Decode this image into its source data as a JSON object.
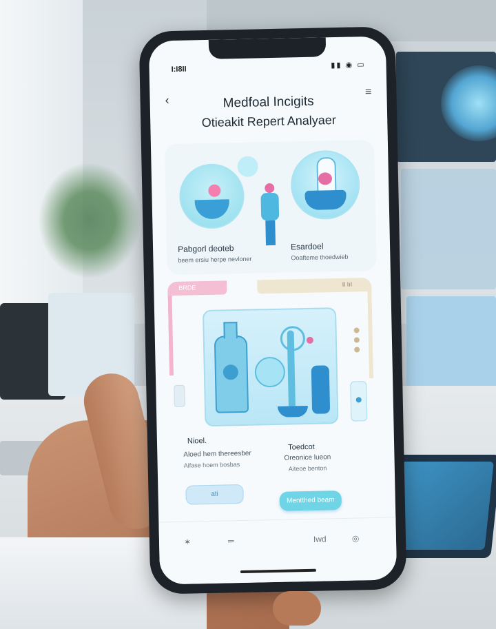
{
  "status": {
    "time": "I:I8II",
    "icons": "▮▮ ◉ ▭"
  },
  "header": {
    "back": "‹",
    "menu": "≡",
    "title": "Medfoal Incigits",
    "subtitle": "Otieakit Repert Analyaer"
  },
  "top_card": {
    "left_label": "Pabgorl deoteb",
    "left_sub": "beem ersiu herpe nevloner",
    "right_label": "Esardoel",
    "right_sub": "Ooafteme thoedwieb"
  },
  "mid_card": {
    "pink_tab": "BRDE",
    "beige_tab": "Il IıI"
  },
  "info": {
    "left_title": "Nioel.",
    "left_line1": "Aloed hem thereesber",
    "left_line2": "Aifase hoem bosbas",
    "right_title": "Toedcot",
    "right_line1": "Oreonice lueon",
    "right_line2": "Aiteoe benton"
  },
  "buttons": {
    "left": "ati",
    "right": "Mentthed beam"
  },
  "tabbar": {
    "tab1": "✶",
    "tab2": "═",
    "tab3": "Iwd",
    "tab4": "◎"
  },
  "colors": {
    "accent": "#6fd4e6",
    "pink": "#f1b6cc",
    "blue": "#2f8ecd"
  }
}
